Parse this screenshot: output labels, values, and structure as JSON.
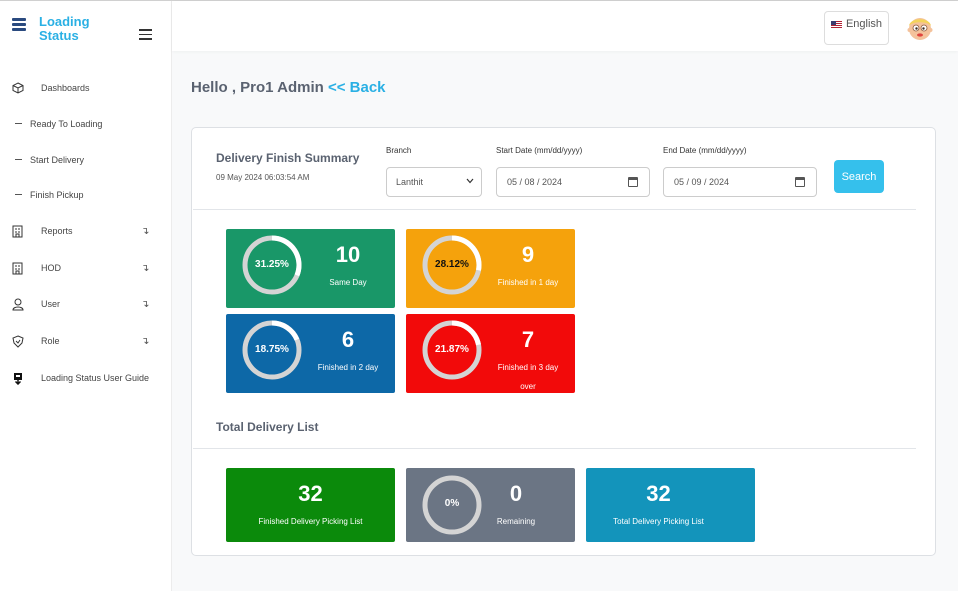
{
  "brand": {
    "line1": "Loading",
    "line2": "Status"
  },
  "sidebar": {
    "items": [
      {
        "label": "Dashboards",
        "icon": "cube-icon",
        "sub": false,
        "caret": false
      },
      {
        "label": "Ready To Loading",
        "icon": "dash-icon",
        "sub": true,
        "caret": false
      },
      {
        "label": "Start Delivery",
        "icon": "dash-icon",
        "sub": true,
        "caret": false
      },
      {
        "label": "Finish Pickup",
        "icon": "dash-icon",
        "sub": true,
        "caret": false
      },
      {
        "label": "Reports",
        "icon": "building-icon",
        "sub": false,
        "caret": true
      },
      {
        "label": "HOD",
        "icon": "building-icon",
        "sub": false,
        "caret": true
      },
      {
        "label": "User",
        "icon": "user-icon",
        "sub": false,
        "caret": true
      },
      {
        "label": "Role",
        "icon": "shield-icon",
        "sub": false,
        "caret": true
      },
      {
        "label": "Loading Status User Guide",
        "icon": "download-icon",
        "sub": false,
        "caret": false
      }
    ],
    "caret_glyph": "↴"
  },
  "topbar": {
    "language": "English"
  },
  "greeting": {
    "text": "Hello , Pro1 Admin",
    "back": "<< Back"
  },
  "summary": {
    "title": "Delivery Finish Summary",
    "datetime": "09 May 2024 06:03:54 AM",
    "branch_label": "Branch",
    "branch_value": "Lanthit",
    "start_label": "Start Date (mm/dd/yyyy)",
    "start_value": "05 / 08 / 2024",
    "end_label": "End Date (mm/dd/yyyy)",
    "end_value": "05 / 09 / 2024",
    "search_label": "Search",
    "cards": [
      {
        "percent": "31.25%",
        "fraction": 0.3125,
        "count": "10",
        "caption1": "Same Day",
        "caption2": "",
        "color": "#199768",
        "text_color": "#ffffff"
      },
      {
        "percent": "28.12%",
        "fraction": 0.2812,
        "count": "9",
        "caption1": "Finished in 1 day",
        "caption2": "",
        "color": "#f5a20c",
        "text_color": "#111111"
      },
      {
        "percent": "18.75%",
        "fraction": 0.1875,
        "count": "6",
        "caption1": "Finished in 2 day",
        "caption2": "",
        "color": "#0d68a7",
        "text_color": "#ffffff"
      },
      {
        "percent": "21.87%",
        "fraction": 0.2187,
        "count": "7",
        "caption1": "Finished in 3 day",
        "caption2": "over",
        "color": "#f20a0a",
        "text_color": "#ffffff"
      }
    ]
  },
  "total": {
    "title": "Total Delivery List",
    "finished": {
      "count": "32",
      "caption": "Finished Delivery Picking List",
      "color": "#0b8a0b"
    },
    "remaining": {
      "percent": "0%",
      "fraction": 0,
      "count": "0",
      "caption": "Remaining",
      "color": "#6b7584"
    },
    "total": {
      "count": "32",
      "caption": "Total Delivery Picking List",
      "color": "#1394bb"
    }
  }
}
